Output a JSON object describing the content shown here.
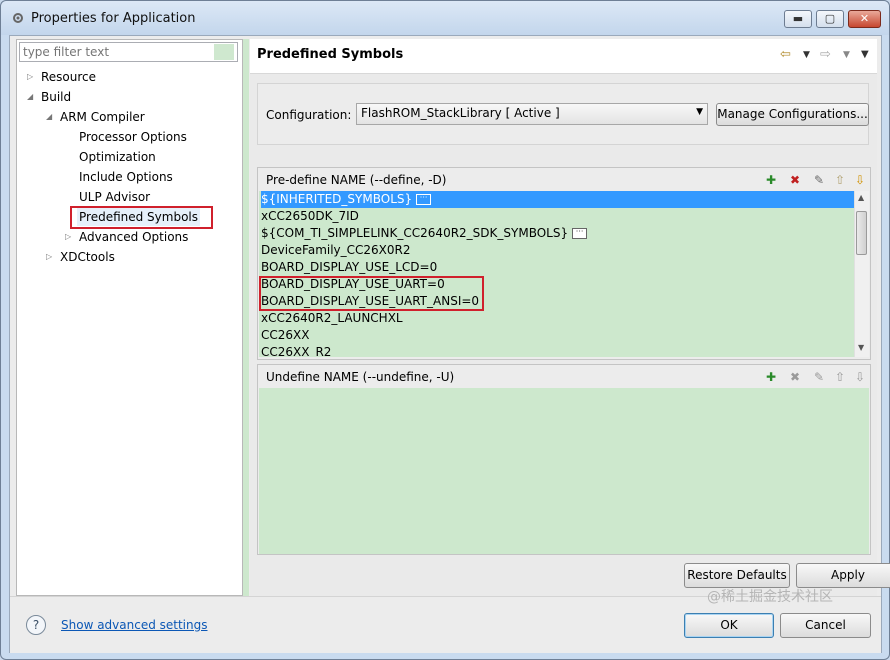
{
  "window": {
    "title": "Properties for Application",
    "minimize_icon": "minimize-icon",
    "maximize_icon": "maximize-icon",
    "close_icon": "close-icon"
  },
  "filter": {
    "placeholder": "type filter text"
  },
  "tree": {
    "resource": "Resource",
    "build": "Build",
    "arm_compiler": "ARM Compiler",
    "processor_options": "Processor Options",
    "optimization": "Optimization",
    "include_options": "Include Options",
    "ulp_advisor": "ULP Advisor",
    "predefined_symbols": "Predefined Symbols",
    "advanced_options": "Advanced Options",
    "xdctools": "XDCtools"
  },
  "page": {
    "title": "Predefined Symbols"
  },
  "config": {
    "label": "Configuration:",
    "value": "FlashROM_StackLibrary  [ Active ]",
    "manage_button": "Manage Configurations..."
  },
  "predefine": {
    "title": "Pre-define NAME (--define, -D)",
    "items": [
      "${INHERITED_SYMBOLS}",
      "xCC2650DK_7ID",
      "${COM_TI_SIMPLELINK_CC2640R2_SDK_SYMBOLS}",
      "DeviceFamily_CC26X0R2",
      "BOARD_DISPLAY_USE_LCD=0",
      "BOARD_DISPLAY_USE_UART=0",
      "BOARD_DISPLAY_USE_UART_ANSI=0",
      "xCC2640R2_LAUNCHXL",
      "CC26XX",
      "CC26XX_R2"
    ]
  },
  "undefine": {
    "title": "Undefine NAME (--undefine, -U)"
  },
  "buttons": {
    "restore_defaults": "Restore Defaults",
    "apply": "Apply",
    "ok": "OK",
    "cancel": "Cancel"
  },
  "footer": {
    "show_advanced": "Show advanced settings"
  },
  "watermark": "@稀土掘金技术社区",
  "colors": {
    "list_bg": "#cde8cd",
    "selection": "#3399ff",
    "highlight_box": "#d0202c",
    "link": "#0b57b5"
  }
}
